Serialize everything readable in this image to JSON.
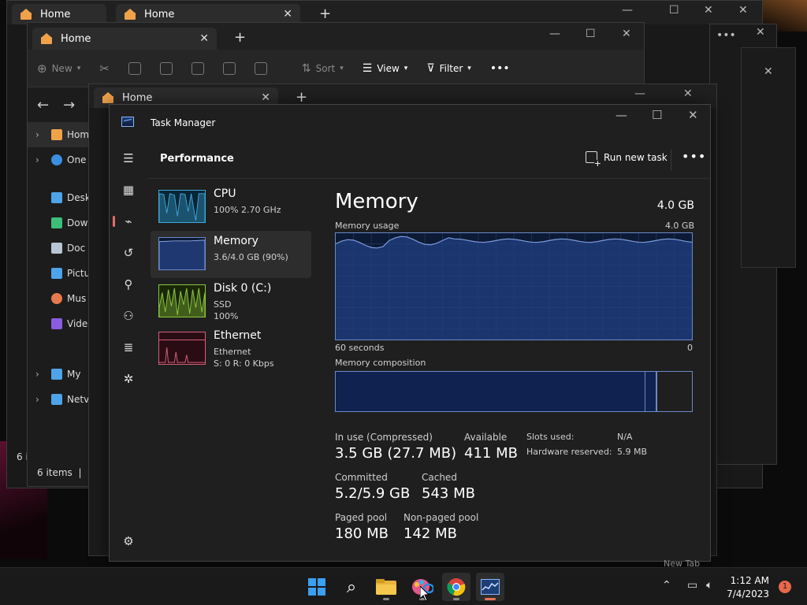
{
  "explorer": {
    "tab_title": "Home",
    "toolbar": {
      "new": "New",
      "sort": "Sort",
      "view": "View",
      "filter": "Filter"
    },
    "sidebar": [
      "Home",
      "One",
      "Desk",
      "Dow",
      "Doc",
      "Pictu",
      "Mus",
      "Vide",
      "My",
      "Netv"
    ],
    "status": "6 items",
    "status_partial": "6 i"
  },
  "task_manager": {
    "title": "Task Manager",
    "section": "Performance",
    "run_new_task": "Run new task",
    "devices": [
      {
        "name": "CPU",
        "line1": "100%  2.70 GHz",
        "line2": ""
      },
      {
        "name": "Memory",
        "line1": "3.6/4.0 GB (90%)",
        "line2": ""
      },
      {
        "name": "Disk 0 (C:)",
        "line1": "SSD",
        "line2": "100%"
      },
      {
        "name": "Ethernet",
        "line1": "Ethernet",
        "line2": "S: 0  R: 0 Kbps"
      }
    ],
    "detail": {
      "title": "Memory",
      "total": "4.0 GB",
      "usage_label": "Memory usage",
      "usage_max": "4.0 GB",
      "time_left": "60 seconds",
      "time_right": "0",
      "composition_label": "Memory composition",
      "composition": {
        "in_use": 0.87,
        "modified": 0.03,
        "standby": 0.1
      },
      "usage_level": 0.9,
      "stats": {
        "in_use_label": "In use (Compressed)",
        "in_use_value": "3.5 GB (27.7 MB)",
        "available_label": "Available",
        "available_value": "411 MB",
        "committed_label": "Committed",
        "committed_value": "5.2/5.9 GB",
        "cached_label": "Cached",
        "cached_value": "543 MB",
        "paged_label": "Paged pool",
        "paged_value": "180 MB",
        "nonpaged_label": "Non-paged pool",
        "nonpaged_value": "142 MB",
        "slots_label": "Slots used:",
        "slots_value": "N/A",
        "hw_label": "Hardware reserved:",
        "hw_value": "5.9 MB"
      }
    }
  },
  "taskbar": {
    "time": "1:12 AM",
    "date": "7/4/2023",
    "notifications": "1",
    "new_tab_label": "New Tab"
  },
  "colors": {
    "accent": "#e66a6a",
    "memory": "#6b88c8",
    "cpu": "#3fa7d6",
    "disk": "#8cc63f",
    "ethernet": "#d0607a"
  }
}
